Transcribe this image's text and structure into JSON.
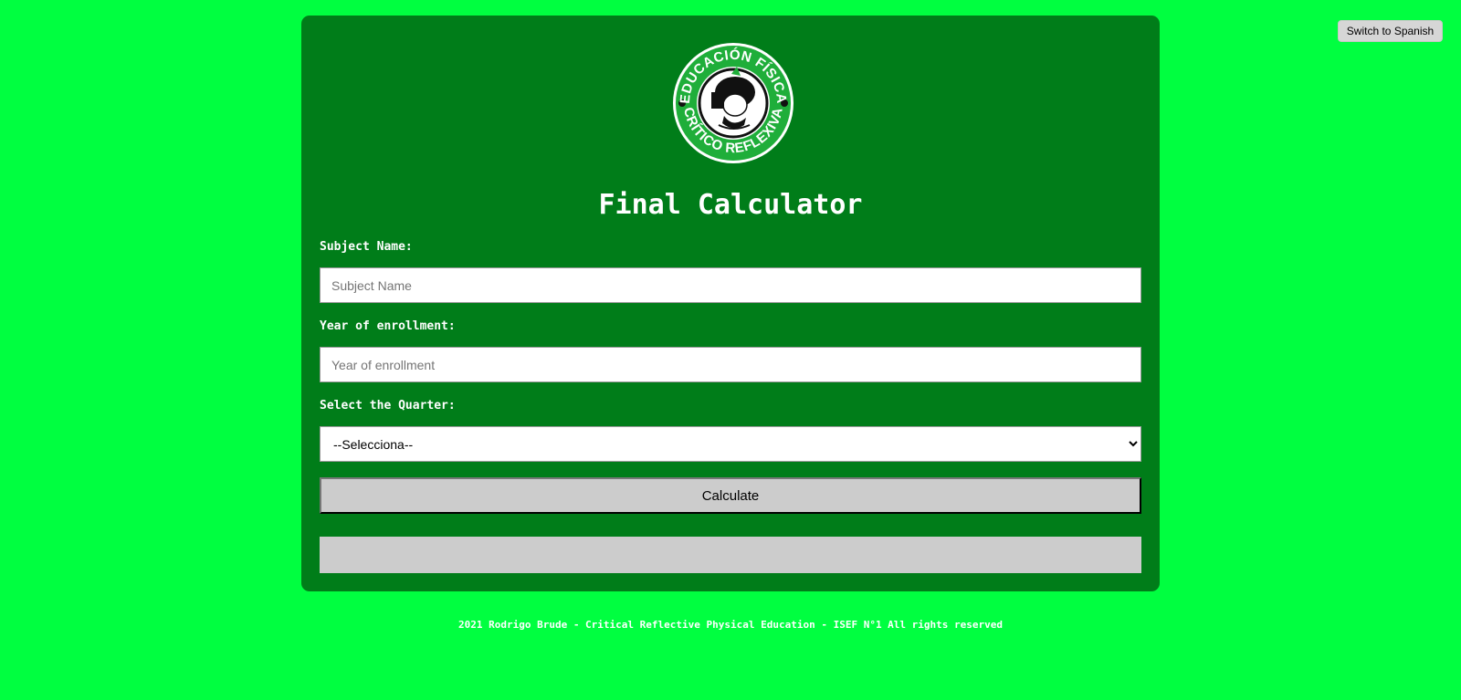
{
  "header": {
    "language_button_label": "Switch to Spanish"
  },
  "logo": {
    "top_text": "EDUCACIÓN FÍSICA",
    "bottom_text": "CRÍTICO REFLEXIVA"
  },
  "form": {
    "title": "Final Calculator",
    "subject_label": "Subject Name:",
    "subject_placeholder": "Subject Name",
    "subject_value": "",
    "year_label": "Year of enrollment:",
    "year_placeholder": "Year of enrollment",
    "year_value": "",
    "quarter_label": "Select the Quarter:",
    "quarter_selected": "--Selecciona--",
    "calculate_label": "Calculate",
    "result_text": ""
  },
  "footer": {
    "text": "2021 Rodrigo Brude - Critical Reflective Physical Education - ISEF N°1 All rights reserved"
  },
  "colors": {
    "page_background": "#00ff40",
    "card_background": "#007d19",
    "logo_green": "#1fae3a",
    "button_gray": "#cccccc"
  },
  "icons": {
    "logo": "educacion-fisica-emblem",
    "dropdown": "chevron-down-icon"
  }
}
